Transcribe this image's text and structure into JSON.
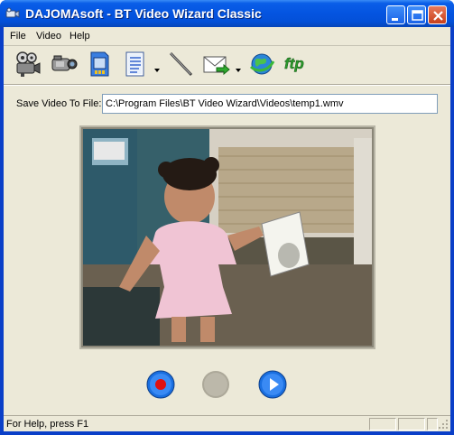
{
  "window": {
    "title": "DAJOMAsoft - BT Video Wizard Classic",
    "app_icon": "video-camera-icon"
  },
  "title_buttons": [
    "minimize-icon",
    "maximize-icon",
    "close-icon"
  ],
  "menubar": {
    "items": [
      {
        "label": "File"
      },
      {
        "label": "Video"
      },
      {
        "label": "Help"
      }
    ]
  },
  "toolbar": {
    "buttons": [
      {
        "icon": "movie-camera-icon",
        "has_dropdown": false
      },
      {
        "icon": "camcorder-icon",
        "has_dropdown": false
      },
      {
        "icon": "sd-card-icon",
        "has_dropdown": false
      },
      {
        "icon": "document-list-icon",
        "has_dropdown": true
      },
      {
        "icon": "wand-icon",
        "has_dropdown": false
      },
      {
        "icon": "email-send-icon",
        "has_dropdown": true
      },
      {
        "icon": "web-globe-icon",
        "has_dropdown": false
      },
      {
        "icon": "ftp-icon",
        "label": "ftp",
        "has_dropdown": false
      }
    ]
  },
  "save": {
    "label": "Save Video To File:",
    "value": "C:\\Program Files\\BT Video Wizard\\Videos\\temp1.wmv"
  },
  "video": {
    "preview_description": "live video frame"
  },
  "controls": {
    "record_icon": "record-icon",
    "stop_icon": "stop-icon",
    "play_icon": "play-icon",
    "stop_disabled": true
  },
  "status": {
    "text": "For Help, press F1"
  },
  "colors": {
    "titlebar": "#0454e0",
    "client_bg": "#ece9d8",
    "record_red": "#e01010",
    "button_blue": "#1a6fe0"
  }
}
